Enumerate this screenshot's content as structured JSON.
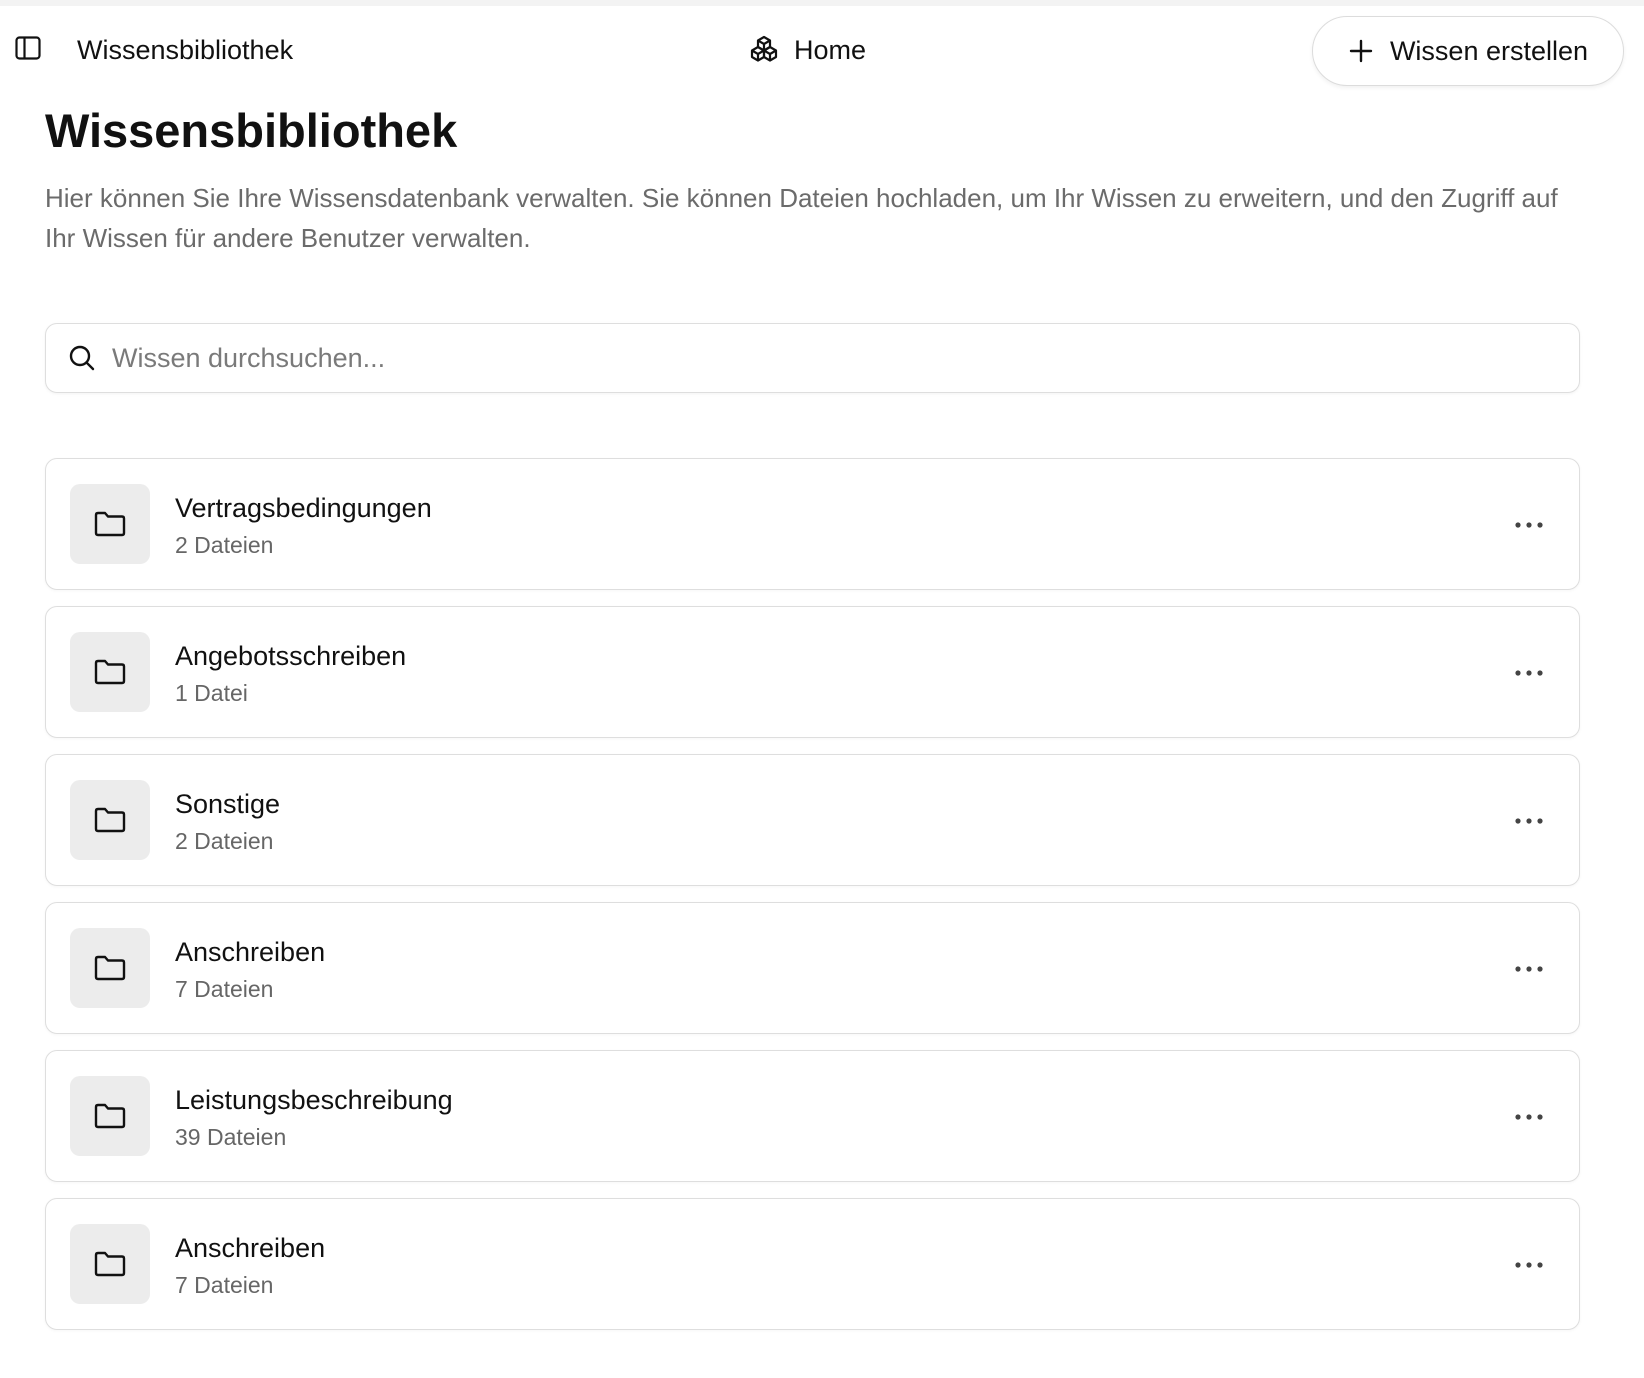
{
  "topbar": {
    "title": "Wissensbibliothek",
    "home_label": "Home",
    "create_button_label": "Wissen erstellen",
    "icons": {
      "sidebar_toggle": "sidebar-toggle-icon",
      "home": "cubes-icon",
      "create": "plus-icon"
    }
  },
  "header": {
    "title": "Wissensbibliothek",
    "description": "Hier können Sie Ihre Wissensdatenbank verwalten. Sie können Dateien hochladen, um Ihr Wissen zu erweitern, und den Zugriff auf Ihr Wissen für andere Benutzer verwalten."
  },
  "search": {
    "placeholder": "Wissen durchsuchen...",
    "value": "",
    "icon": "search-icon"
  },
  "items": [
    {
      "name": "Vertragsbedingungen",
      "count": "2 Dateien",
      "icon": "folder-icon"
    },
    {
      "name": "Angebotsschreiben",
      "count": "1 Datei",
      "icon": "folder-icon"
    },
    {
      "name": "Sonstige",
      "count": "2 Dateien",
      "icon": "folder-icon"
    },
    {
      "name": "Anschreiben",
      "count": "7 Dateien",
      "icon": "folder-icon"
    },
    {
      "name": "Leistungsbeschreibung",
      "count": "39 Dateien",
      "icon": "folder-icon"
    },
    {
      "name": "Anschreiben",
      "count": "7 Dateien",
      "icon": "folder-icon"
    }
  ],
  "colors": {
    "text": "#111111",
    "muted_text": "#6b6b6b",
    "border": "#dedede",
    "folder_tile_bg": "#ececec",
    "background": "#ffffff"
  }
}
